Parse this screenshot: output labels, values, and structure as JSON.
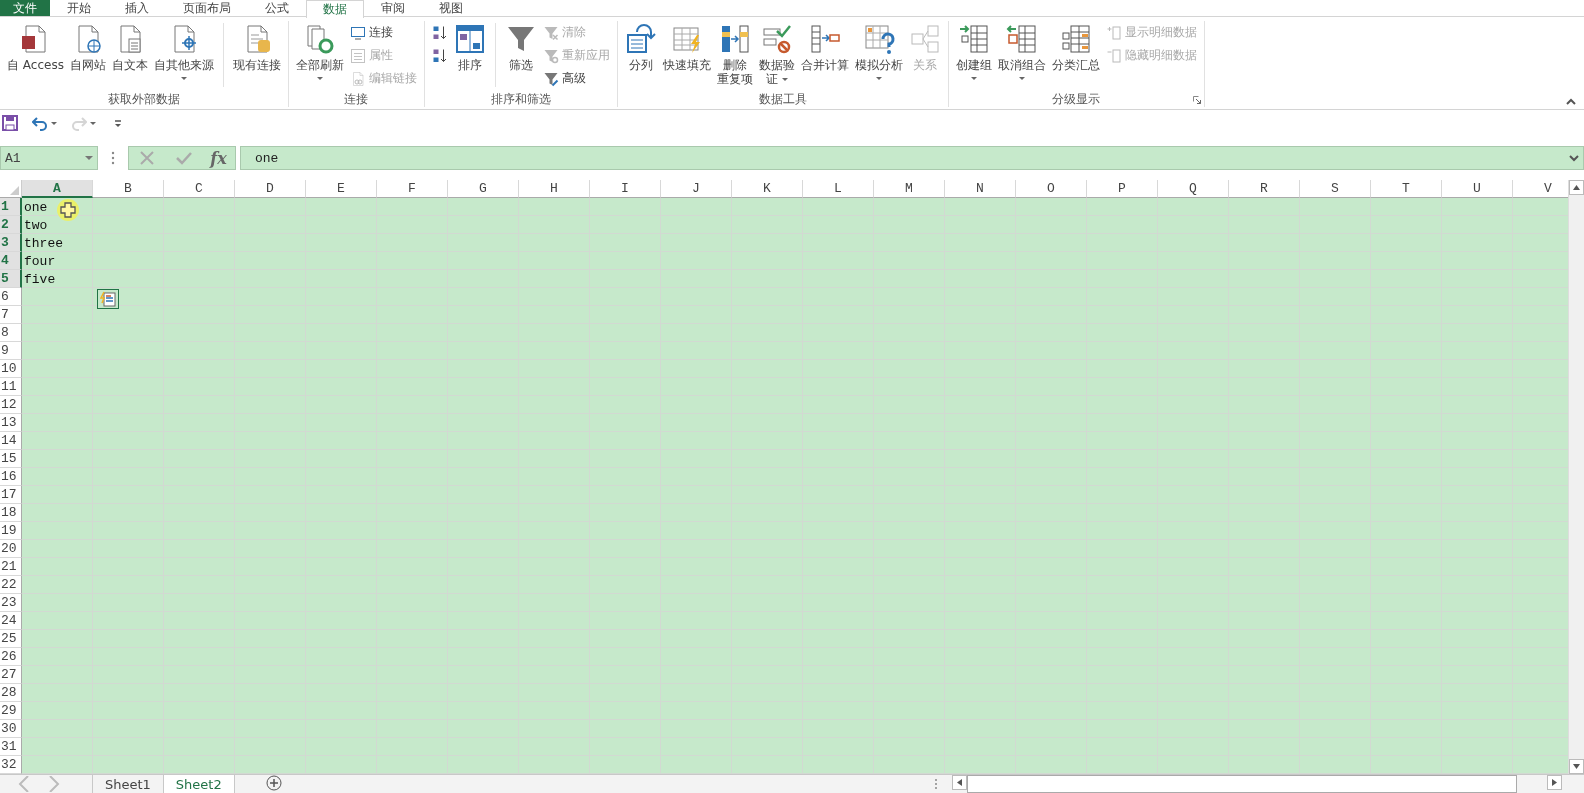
{
  "tabs": [
    {
      "label": "文件",
      "kind": "backstage",
      "selected": false
    },
    {
      "label": "开始",
      "kind": "tab",
      "selected": false
    },
    {
      "label": "插入",
      "kind": "tab",
      "selected": false
    },
    {
      "label": "页面布局",
      "kind": "tab",
      "selected": false
    },
    {
      "label": "公式",
      "kind": "tab",
      "selected": false
    },
    {
      "label": "数据",
      "kind": "tab",
      "selected": true
    },
    {
      "label": "审阅",
      "kind": "tab",
      "selected": false
    },
    {
      "label": "视图",
      "kind": "tab",
      "selected": false
    }
  ],
  "ribbon": {
    "groups": [
      {
        "label": "获取外部数据",
        "launcher": false,
        "items": [
          {
            "kind": "large",
            "label": "自 Access",
            "dropdown": false,
            "disabled": false
          },
          {
            "kind": "large",
            "label": "自网站",
            "dropdown": false,
            "disabled": false
          },
          {
            "kind": "large",
            "label": "自文本",
            "dropdown": false,
            "disabled": false
          },
          {
            "kind": "large",
            "label": "自其他来源",
            "dropdown": true,
            "disabled": false
          },
          {
            "kind": "separator"
          },
          {
            "kind": "large",
            "label": "现有连接",
            "dropdown": false,
            "disabled": false
          }
        ]
      },
      {
        "label": "连接",
        "launcher": false,
        "items": [
          {
            "kind": "large",
            "label": "全部刷新",
            "dropdown": true,
            "disabled": false
          },
          {
            "kind": "stack",
            "buttons": [
              {
                "label": "连接",
                "disabled": false
              },
              {
                "label": "属性",
                "disabled": true
              },
              {
                "label": "编辑链接",
                "disabled": true
              }
            ]
          }
        ]
      },
      {
        "label": "排序和筛选",
        "launcher": false,
        "items": [
          {
            "kind": "stack",
            "buttons": [
              {
                "disabled": false
              },
              {
                "disabled": false
              }
            ]
          },
          {
            "kind": "large",
            "label": "排序",
            "dropdown": false,
            "disabled": false
          },
          {
            "kind": "separator"
          },
          {
            "kind": "large",
            "label": "筛选",
            "dropdown": false,
            "disabled": false
          },
          {
            "kind": "stack",
            "buttons": [
              {
                "label": "清除",
                "disabled": true
              },
              {
                "label": "重新应用",
                "disabled": true
              },
              {
                "label": "高级",
                "disabled": false
              }
            ]
          }
        ]
      },
      {
        "label": "数据工具",
        "launcher": false,
        "items": [
          {
            "kind": "large",
            "label": "分列",
            "dropdown": false,
            "disabled": false
          },
          {
            "kind": "large",
            "label": "快速填充",
            "dropdown": false,
            "disabled": false
          },
          {
            "kind": "large",
            "lines": [
              "删除",
              "重复项"
            ],
            "dropdown": false,
            "disabled": false
          },
          {
            "kind": "large",
            "lines": [
              "数据验",
              "证"
            ],
            "dropdown": true,
            "disabled": false
          },
          {
            "kind": "large",
            "label": "合并计算",
            "dropdown": false,
            "disabled": false
          },
          {
            "kind": "large",
            "label": "模拟分析",
            "dropdown": true,
            "disabled": false
          },
          {
            "kind": "large",
            "label": "关系",
            "dropdown": false,
            "disabled": true
          }
        ]
      },
      {
        "label": "分级显示",
        "launcher": true,
        "items": [
          {
            "kind": "large",
            "label": "创建组",
            "dropdown": true,
            "disabled": false
          },
          {
            "kind": "large",
            "label": "取消组合",
            "dropdown": true,
            "disabled": false
          },
          {
            "kind": "large",
            "label": "分类汇总",
            "dropdown": false,
            "disabled": false
          },
          {
            "kind": "stack",
            "buttons": [
              {
                "label": "显示明细数据",
                "disabled": true
              },
              {
                "label": "隐藏明细数据",
                "disabled": true
              }
            ]
          }
        ]
      }
    ]
  },
  "quick_access": [
    {
      "kind": "save",
      "dropdown": false,
      "disabled": false
    },
    {
      "kind": "undo",
      "dropdown": true,
      "disabled": false
    },
    {
      "kind": "redo",
      "dropdown": true,
      "disabled": true
    },
    {
      "kind": "customize",
      "dropdown": false,
      "disabled": false
    }
  ],
  "formula_bar": {
    "name_box": "A1",
    "function_label": "fx",
    "value": "one"
  },
  "sheet": {
    "columns": [
      {
        "label": "A",
        "selected": true
      },
      {
        "label": "B",
        "selected": false
      },
      {
        "label": "C",
        "selected": false
      },
      {
        "label": "D",
        "selected": false
      },
      {
        "label": "E",
        "selected": false
      },
      {
        "label": "F",
        "selected": false
      },
      {
        "label": "G",
        "selected": false
      },
      {
        "label": "H",
        "selected": false
      },
      {
        "label": "I",
        "selected": false
      },
      {
        "label": "J",
        "selected": false
      },
      {
        "label": "K",
        "selected": false
      },
      {
        "label": "L",
        "selected": false
      },
      {
        "label": "M",
        "selected": false
      },
      {
        "label": "N",
        "selected": false
      },
      {
        "label": "O",
        "selected": false
      },
      {
        "label": "P",
        "selected": false
      },
      {
        "label": "Q",
        "selected": false
      },
      {
        "label": "R",
        "selected": false
      },
      {
        "label": "S",
        "selected": false
      },
      {
        "label": "T",
        "selected": false
      },
      {
        "label": "U",
        "selected": false
      },
      {
        "label": "V",
        "selected": false
      }
    ],
    "rows": [
      {
        "label": "1",
        "selected": true,
        "cells": [
          "one"
        ]
      },
      {
        "label": "2",
        "selected": true,
        "cells": [
          "two"
        ]
      },
      {
        "label": "3",
        "selected": true,
        "cells": [
          "three"
        ]
      },
      {
        "label": "4",
        "selected": true,
        "cells": [
          "four"
        ]
      },
      {
        "label": "5",
        "selected": true,
        "cells": [
          "five"
        ]
      },
      {
        "label": "6",
        "selected": false
      },
      {
        "label": "7",
        "selected": false
      },
      {
        "label": "8",
        "selected": false
      },
      {
        "label": "9",
        "selected": false
      },
      {
        "label": "10",
        "selected": false
      },
      {
        "label": "11",
        "selected": false
      },
      {
        "label": "12",
        "selected": false
      },
      {
        "label": "13",
        "selected": false
      },
      {
        "label": "14",
        "selected": false
      },
      {
        "label": "15",
        "selected": false
      },
      {
        "label": "16",
        "selected": false
      },
      {
        "label": "17",
        "selected": false
      },
      {
        "label": "18",
        "selected": false
      },
      {
        "label": "19",
        "selected": false
      },
      {
        "label": "20",
        "selected": false
      },
      {
        "label": "21",
        "selected": false
      },
      {
        "label": "22",
        "selected": false
      },
      {
        "label": "23",
        "selected": false
      },
      {
        "label": "24",
        "selected": false
      },
      {
        "label": "25",
        "selected": false
      },
      {
        "label": "26",
        "selected": false
      },
      {
        "label": "27",
        "selected": false
      },
      {
        "label": "28",
        "selected": false
      },
      {
        "label": "29",
        "selected": false
      },
      {
        "label": "30",
        "selected": false
      },
      {
        "label": "31",
        "selected": false
      },
      {
        "label": "32",
        "selected": false
      }
    ]
  },
  "sheet_tabs": [
    {
      "label": "Sheet1",
      "selected": false
    },
    {
      "label": "Sheet2",
      "selected": true
    }
  ]
}
